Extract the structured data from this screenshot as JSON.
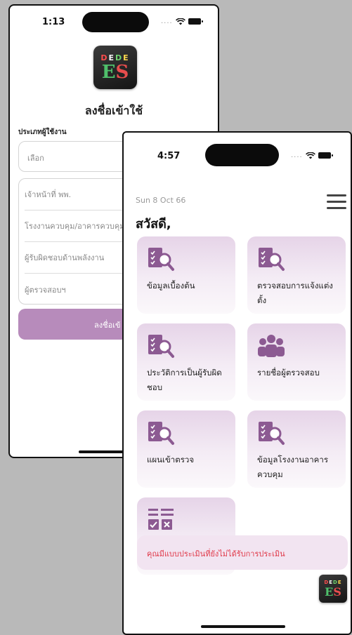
{
  "login_screen": {
    "status_time": "1:13",
    "signal_dots": "....",
    "logo": {
      "top_letters": [
        "D",
        "E",
        "D",
        "E"
      ],
      "big_letters": [
        "E",
        "S"
      ]
    },
    "title": "ลงชื่อเข้าใช้",
    "user_type_label": "ประเภทผู้ใช้งาน",
    "select_placeholder": "เลือก",
    "roles": [
      "เจ้าหน้าที่ พพ.",
      "โรงงานควบคุม/อาคารควบคุม",
      "ผู้รับผิดชอบด้านพลังงาน",
      "ผู้ตรวจสอบฯ"
    ],
    "login_button": "ลงชื่อเข้"
  },
  "home_screen": {
    "status_time": "4:57",
    "signal_dots": "....",
    "date": "Sun 8 Oct 66",
    "greeting": "สวัสดี,",
    "cards": [
      {
        "label": "ข้อมูลเบื้องต้น",
        "icon": "document-search-icon"
      },
      {
        "label": "ตรวจสอบการแจ้งแต่งตั้ง",
        "icon": "document-search-icon"
      },
      {
        "label": "ประวัติการเป็นผู้รับผิดชอบ",
        "icon": "document-search-icon"
      },
      {
        "label": "รายชื่อผู้ตรวจสอบ",
        "icon": "people-icon"
      },
      {
        "label": "แผนเข้าตรวจ",
        "icon": "document-search-icon"
      },
      {
        "label": "ข้อมูลโรงงานอาคารควบคุม",
        "icon": "document-search-icon"
      },
      {
        "label": "",
        "icon": "table-checklist-icon"
      }
    ],
    "alert_text": "คุณมีแบบประเมินที่ยังไม่ได้รับการประเมิน",
    "colors": {
      "accent": "#b78bbb",
      "card": "#ecdcee",
      "alert_text": "#e03a4a"
    }
  }
}
